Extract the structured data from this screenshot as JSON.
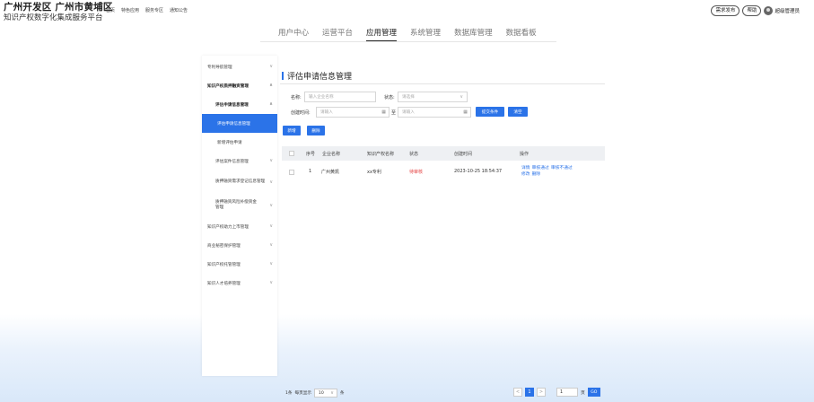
{
  "header": {
    "title_line1": "广州开发区 广州市黄埔区",
    "title_line2": "知识产权数字化集成服务平台",
    "top_nav": [
      "首页",
      "特色应用",
      "服务专区",
      "通知公告"
    ],
    "requirement_button": "需求发布",
    "help_button": "帮助",
    "user_name": "超级管理员"
  },
  "main_nav": {
    "items": [
      "用户中心",
      "运营平台",
      "应用管理",
      "系统管理",
      "数据库管理",
      "数据看板"
    ],
    "active": "应用管理"
  },
  "sidebar": {
    "items": [
      {
        "label": "专利导航管理",
        "chev": "∨"
      },
      {
        "label": "知识产权质押融资管理",
        "chev": "∧"
      },
      {
        "label": "评估申请信息管理",
        "chev": "∧"
      },
      {
        "label": "评估申请信息管理"
      },
      {
        "label": "新增评估申请"
      },
      {
        "label": "评估案件信息管理",
        "chev": "∨"
      },
      {
        "label": "质押融资需求登记信息管理",
        "chev": "∨"
      },
      {
        "label": "质押融资风险补偿资金管理",
        "chev": "∨"
      },
      {
        "label": "知识产权助力上市管理",
        "chev": "∨"
      },
      {
        "label": "商业秘密保护管理",
        "chev": "∨"
      },
      {
        "label": "知识产权托管管理",
        "chev": "∨"
      },
      {
        "label": "知识人才培养管理",
        "chev": "∨"
      }
    ]
  },
  "page": {
    "title": "评估申请信息管理",
    "name_label": "名称:",
    "name_placeholder": "输入企业名称",
    "status_label": "状态:",
    "status_placeholder": "请选择",
    "created_label": "创建时间:",
    "date_placeholder_start": "请输入",
    "date_separator": "至",
    "date_placeholder_end": "请输入",
    "submit_button": "提交条件",
    "clear_button": "清空",
    "add_button": "新增",
    "delete_button": "删除"
  },
  "table": {
    "columns": [
      "序号",
      "企业名称",
      "知识产权名称",
      "状态",
      "创建时间",
      "操作"
    ],
    "rows": [
      {
        "index": "1",
        "company": "广州黄凯",
        "ip_name": "xx专利",
        "status": "待审核",
        "created": "2023-10-25 18:54:37",
        "actions": [
          "详情",
          "审核通过",
          "审核不通过",
          "修改",
          "删除"
        ]
      }
    ]
  },
  "pagination": {
    "total_text": "1条",
    "per_page_label": "每页显示",
    "per_page_value": "10",
    "unit": "条",
    "prev": "<",
    "current_page": "1",
    "next": ">",
    "goto_value": "1",
    "page_unit": "页",
    "go_button": "GO"
  },
  "colors": {
    "accent": "#2b73e8",
    "status_pending": "#e54545"
  }
}
